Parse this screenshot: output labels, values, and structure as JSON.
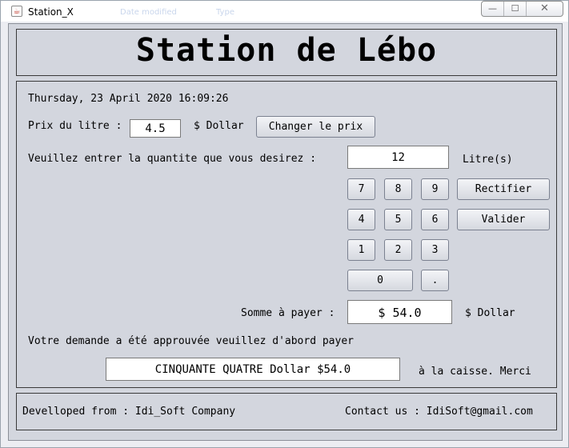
{
  "window": {
    "title": "Station_X",
    "ghost_left": "Date modified",
    "ghost_right": "Type",
    "controls": {
      "minimize": "—",
      "maximize": "☐",
      "close": "✕"
    }
  },
  "header": {
    "title": "Station de Lébo"
  },
  "main": {
    "datetime": "Thursday, 23 April  2020   16:09:26",
    "price_label": "Prix du litre :",
    "price_value": "4.5",
    "price_unit": "$ Dollar",
    "change_price_button": "Changer le prix",
    "quantity_label": "Veuillez entrer la quantite que vous desirez :",
    "quantity_value": "12",
    "quantity_unit": "Litre(s)",
    "keypad": {
      "k7": "7",
      "k8": "8",
      "k9": "9",
      "k4": "4",
      "k5": "5",
      "k6": "6",
      "k1": "1",
      "k2": "2",
      "k3": "3",
      "k0": "0",
      "kdot": "."
    },
    "rectifier_button": "Rectifier",
    "valider_button": "Valider",
    "sum_label": "Somme à payer :",
    "sum_value": "$ 54.0",
    "sum_unit": "$ Dollar",
    "approval_message": "Votre demande a été approuvée veuillez d'abord payer",
    "amount_words": "CINQUANTE QUATRE  Dollar $54.0",
    "cashier_message": "à la caisse. Merci"
  },
  "footer": {
    "developed_by": "Develloped from :  Idi_Soft Company",
    "contact": "Contact us :  IdiSoft@gmail.com"
  }
}
